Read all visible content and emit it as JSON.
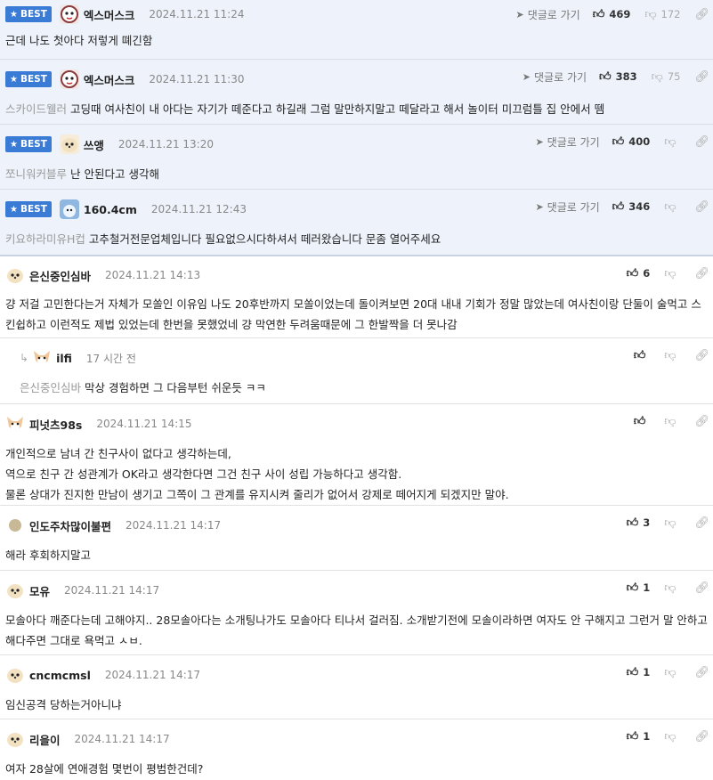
{
  "ui": {
    "best_label": "BEST",
    "reply_link_label": "댓글로 가기"
  },
  "comments": [
    {
      "nick": "엑스머스크",
      "date": "2024.11.21 11:24",
      "ref": "",
      "text": "근데 나도 첫아다 저렇게 뗴긴함",
      "up": "469",
      "down": "172"
    },
    {
      "nick": "엑스머스크",
      "date": "2024.11.21 11:30",
      "ref": "스카이드웰러",
      "text": "고딩때 여사친이 내 아다는 자기가 떼준다고 하길래 그럼 말만하지말고 떼달라고 해서 놀이터 미끄럼틀 집 안에서 뗌",
      "up": "383",
      "down": "75"
    },
    {
      "nick": "쓰앵",
      "date": "2024.11.21 13:20",
      "ref": "쪼니워커블루",
      "text": "난 안된다고 생각해",
      "up": "400",
      "down": ""
    },
    {
      "nick": "160.4cm",
      "date": "2024.11.21 12:43",
      "ref": "키요하라미유H컵",
      "text": "고추철거전문업체입니다 필요없으시다하셔서 떼러왔습니다 문좀 열어주세요",
      "up": "346",
      "down": ""
    },
    {
      "nick": "은신중인심바",
      "date": "2024.11.21 14:13",
      "ref": "",
      "text": "걍 저걸 고민한다는거 자체가 모쏠인 이유임 나도 20후반까지 모쏠이었는데 돌이켜보면 20대 내내 기회가 정말 많았는데 여사친이랑 단둘이 술먹고 스킨쉽하고 이런적도 제법 있었는데 한번을 못했었네 걍 막연한 두려움때문에 그 한발짝을 더 못나감",
      "up": "6",
      "down": ""
    },
    {
      "nick": "ilfi",
      "date": "17 시간 전",
      "ref": "은신중인심바",
      "text": "막상 경험하면 그 다음부턴 쉬운듯 ㅋㅋ",
      "up": "",
      "down": ""
    },
    {
      "nick": "피넛츠98s",
      "date": "2024.11.21 14:15",
      "ref": "",
      "text_lines": [
        "개인적으로 남녀 간 친구사이 없다고 생각하는데,",
        "역으로 친구 간 성관계가 OK라고 생각한다면 그건 친구 사이 성립 가능하다고 생각함.",
        "물론 상대가 진지한 만남이 생기고 그쪽이 그 관계를 유지시켜 줄리가 없어서 강제로 떼어지게 되겠지만 말야."
      ],
      "up": "",
      "down": ""
    },
    {
      "nick": "인도주차많이불편",
      "date": "2024.11.21 14:17",
      "ref": "",
      "text": "해라 후회하지말고",
      "up": "3",
      "down": ""
    },
    {
      "nick": "모유",
      "date": "2024.11.21 14:17",
      "ref": "",
      "text": "모솔아다 깨준다는데 고해야지.. 28모솔아다는 소개팅나가도 모솔아다 티나서 걸러짐. 소개받기전에 모솔이라하면 여자도 안 구해지고 그런거 말 안하고 해다주면 그대로 욕먹고 ㅅㅂ.",
      "up": "1",
      "down": ""
    },
    {
      "nick": "cncmcmsl",
      "date": "2024.11.21 14:17",
      "ref": "",
      "text": "임신공격 당하는거아니냐",
      "up": "1",
      "down": ""
    },
    {
      "nick": "리을이",
      "date": "2024.11.21 14:17",
      "ref": "",
      "text": "여자 28살에 연애경험 몇번이 평범한건데?",
      "up": "1",
      "down": ""
    }
  ],
  "icons": {
    "accent": "#3a7bd5",
    "up": "thumbs-up-icon",
    "down": "thumbs-down-icon",
    "share": "link-icon",
    "reply": "send-icon"
  }
}
